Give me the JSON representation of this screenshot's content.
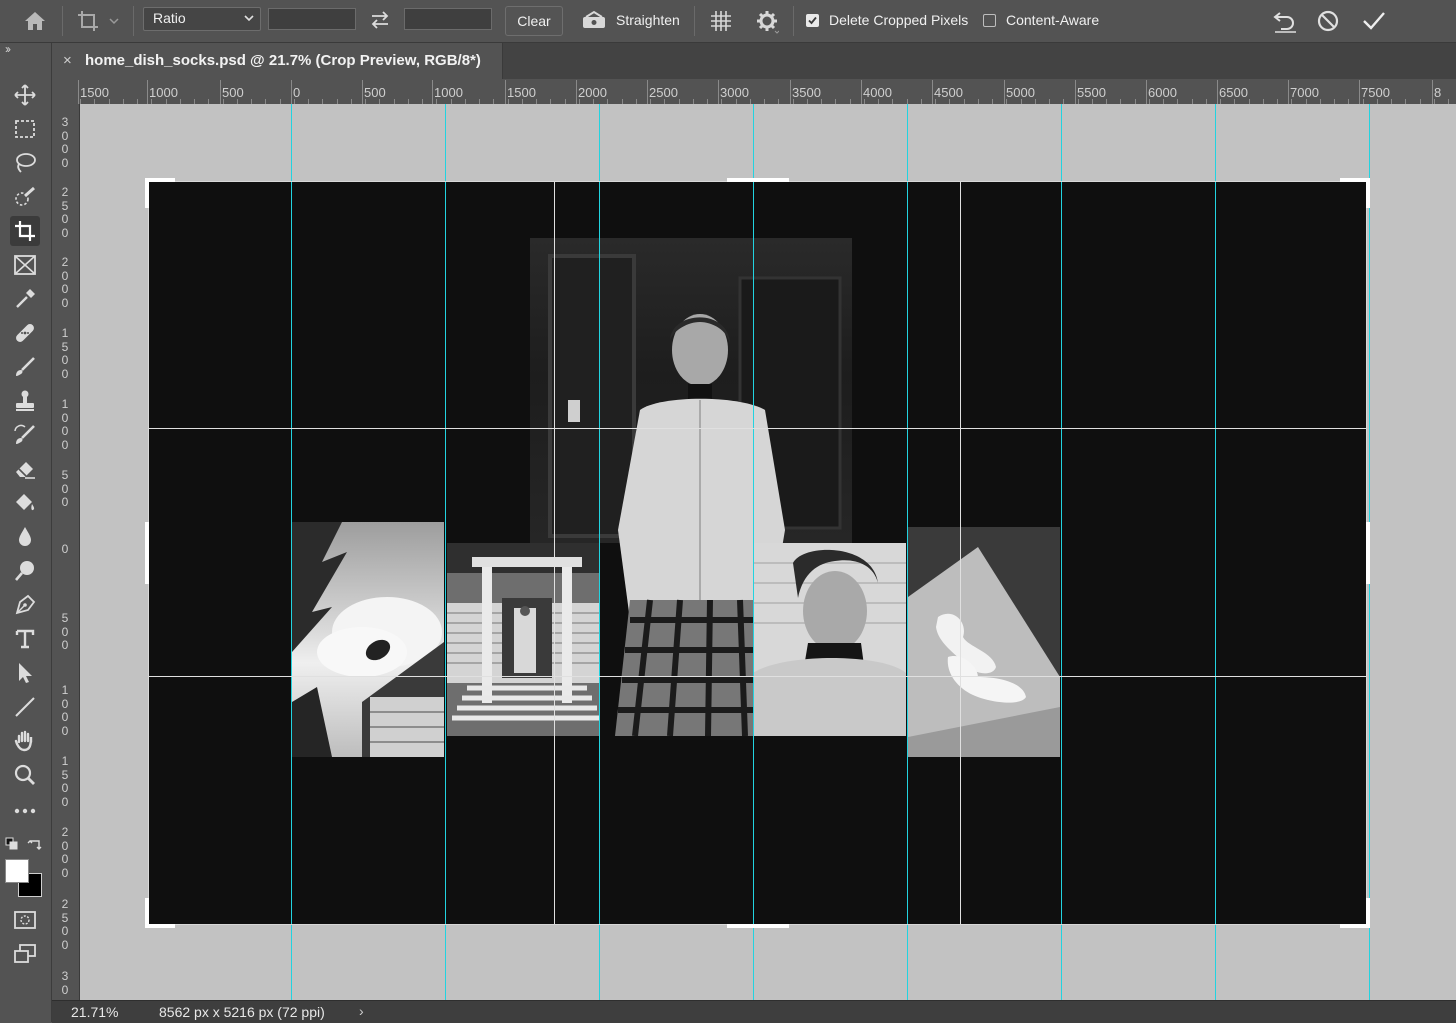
{
  "options_bar": {
    "ratio_label": "Ratio",
    "width_value": "",
    "height_value": "",
    "clear_label": "Clear",
    "straighten_label": "Straighten",
    "delete_cropped_label": "Delete Cropped Pixels",
    "delete_cropped_checked": true,
    "content_aware_label": "Content-Aware",
    "content_aware_checked": false
  },
  "document": {
    "tab_title": "home_dish_socks.psd @ 21.7% (Crop Preview, RGB/8*)",
    "close_glyph": "×"
  },
  "ruler_top": {
    "labels": [
      "1500",
      "1000",
      "500",
      "0",
      "500",
      "1000",
      "1500",
      "2000",
      "2500",
      "3000",
      "3500",
      "4000",
      "4500",
      "5000",
      "5500",
      "6000",
      "6500",
      "7000",
      "7500",
      "8"
    ]
  },
  "ruler_left": {
    "labels": [
      "3000",
      "2500",
      "2000",
      "1500",
      "1000",
      "500",
      "0",
      "500",
      "1000",
      "1500",
      "2000",
      "2500",
      "30"
    ]
  },
  "toolbar": {
    "expand_glyph": "››",
    "foreground_color": "#ffffff",
    "background_color": "#000000",
    "tools": [
      "move-tool",
      "marquee-tool",
      "lasso-tool",
      "quick-selection-tool",
      "crop-tool",
      "frame-tool",
      "eyedropper-tool",
      "healing-brush-tool",
      "brush-tool",
      "clone-stamp-tool",
      "history-brush-tool",
      "eraser-tool",
      "paint-bucket-tool",
      "blur-tool",
      "dodge-tool",
      "pen-tool",
      "type-tool",
      "path-selection-tool",
      "line-tool",
      "hand-tool",
      "zoom-tool",
      "more-tools"
    ]
  },
  "status_bar": {
    "zoom": "21.71%",
    "doc_info": "8562 px x 5216 px (72 ppi)",
    "arrow": "›"
  },
  "colors": {
    "guide": "#22d3e0",
    "canvas_bg": "#c2c2c2",
    "artboard": "#0f0f0f",
    "ui_bg": "#535353"
  }
}
